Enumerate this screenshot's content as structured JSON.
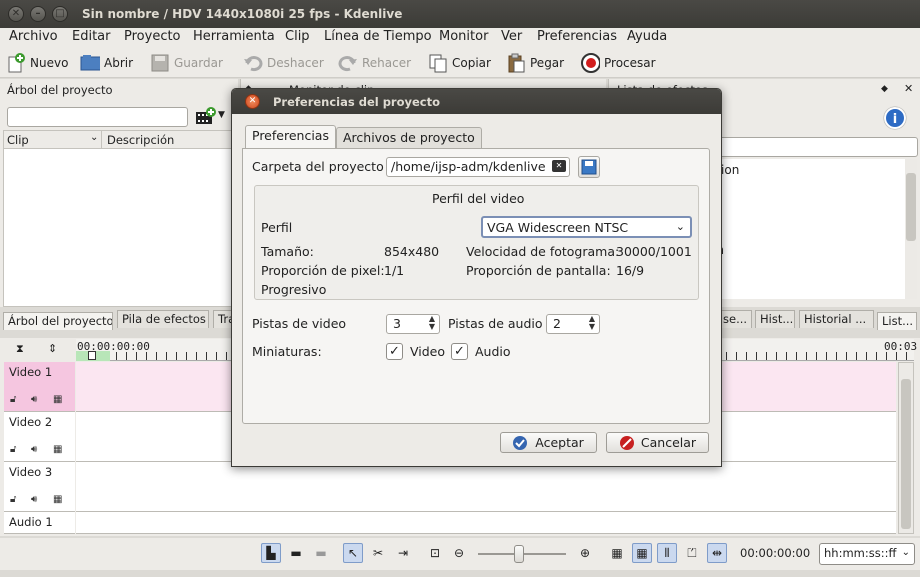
{
  "window": {
    "title": "Sin nombre / HDV 1440x1080i 25 fps - Kdenlive"
  },
  "menubar": [
    "Archivo",
    "Editar",
    "Proyecto",
    "Herramienta",
    "Clip",
    "Línea de Tiempo",
    "Monitor",
    "Ver",
    "Preferencias",
    "Ayuda"
  ],
  "toolbar": {
    "nuevo": "Nuevo",
    "abrir": "Abrir",
    "guardar": "Guardar",
    "deshacer": "Deshacer",
    "rehacer": "Rehacer",
    "copiar": "Copiar",
    "pegar": "Pegar",
    "procesar": "Procesar"
  },
  "project_tree": {
    "title": "Árbol del proyecto",
    "col_clip": "Clip",
    "col_desc": "Descripción"
  },
  "clip_monitor_title": "Monitor de clip",
  "effects_list_title": "Lista de efectos",
  "effects_partial": [
    "ation",
    "n",
    "on"
  ],
  "bottom_tabs_left": [
    "Árbol del proyecto",
    "Pila de efectos",
    "Tra"
  ],
  "bottom_tabs_right": [
    "se...",
    "Hist...",
    "Historial ...",
    "List..."
  ],
  "timeline": {
    "ruler_start": "00:00:00:00",
    "ruler_end": "00:03",
    "tracks": [
      "Video 1",
      "Video 2",
      "Video 3",
      "Audio 1"
    ]
  },
  "statusbar": {
    "timecode": "00:00:00:00",
    "format": "hh:mm:ss::ff"
  },
  "dialog": {
    "title": "Preferencias del proyecto",
    "tabs": [
      "Preferencias",
      "Archivos de proyecto"
    ],
    "carpeta_label": "Carpeta del proyecto",
    "carpeta_value": "/home/ijsp-adm/kdenlive",
    "perfil_group": "Perfil del video",
    "perfil_label": "Perfil",
    "perfil_value": "VGA Widescreen NTSC",
    "tamano_label": "Tamaño:",
    "tamano_value": "854x480",
    "fps_label": "Velocidad de fotograma:",
    "fps_value": "30000/1001",
    "pixel_label": "Proporción de pixel:",
    "pixel_value": "1/1",
    "pantalla_label": "Proporción de pantalla:",
    "pantalla_value": "16/9",
    "progresivo": "Progresivo",
    "pistas_video_label": "Pistas de video",
    "pistas_video_value": "3",
    "pistas_audio_label": "Pistas de audio",
    "pistas_audio_value": "2",
    "miniaturas_label": "Miniaturas:",
    "chk_video": "Video",
    "chk_audio": "Audio",
    "accept": "Aceptar",
    "cancel": "Cancelar"
  }
}
